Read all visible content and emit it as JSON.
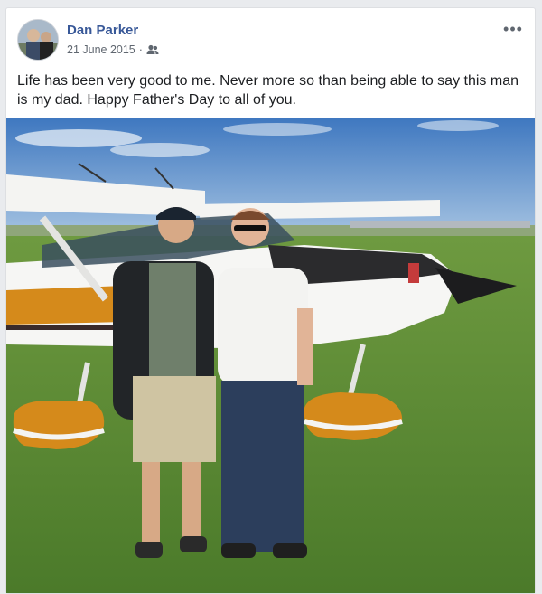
{
  "post": {
    "author": "Dan Parker",
    "date": "21 June 2015",
    "separator": "·",
    "audience_icon": "friends-icon",
    "more_label": "•••",
    "text": "Life has been very good to me. Never more so than being able to say this man is my dad. Happy Father's Day to all of you."
  },
  "colors": {
    "author": "#385898",
    "sky": "#4f86c6",
    "grass": "#5c8a35",
    "plane_trim": "#d58a1b"
  }
}
